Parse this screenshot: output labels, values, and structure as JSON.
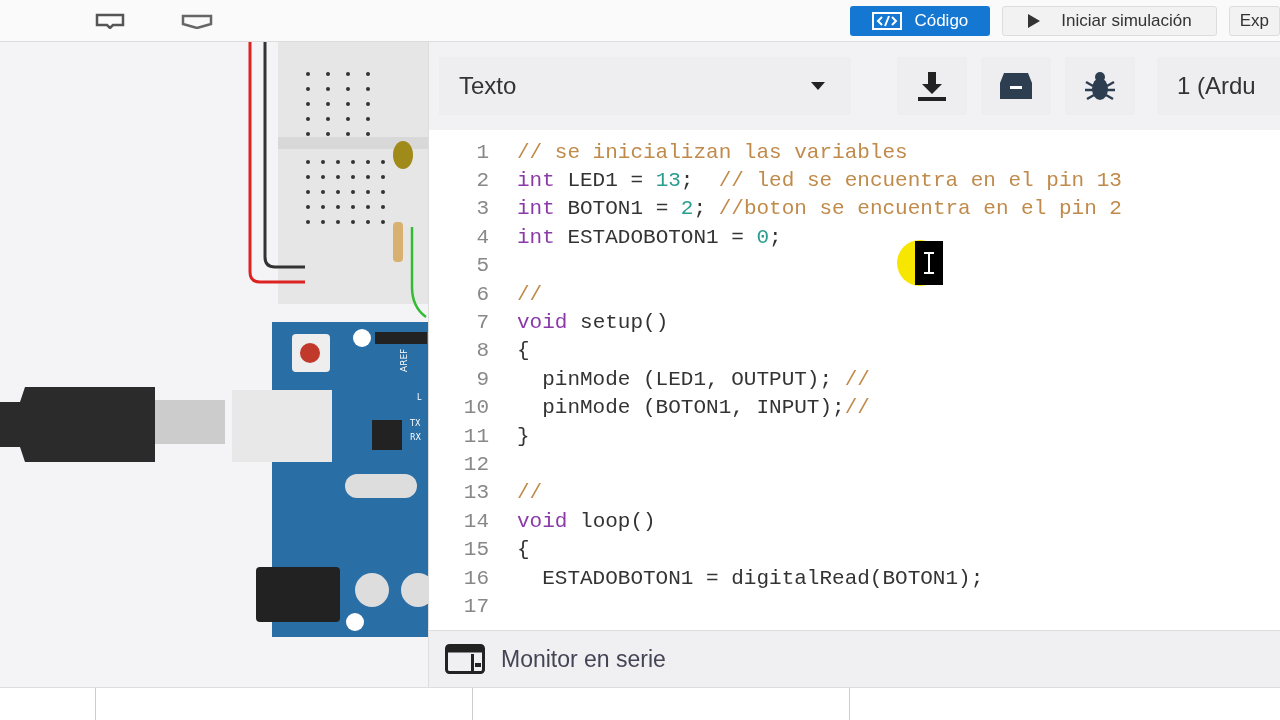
{
  "top_bar": {
    "code_button": "Código",
    "simulate_button": "Iniciar simulación",
    "export_button": "Exp"
  },
  "editor_toolbar": {
    "mode_select": "Texto",
    "board_select": "1 (Ardu"
  },
  "circuit": {
    "board_labels": [
      "AREF",
      "L",
      "TX",
      "RX"
    ]
  },
  "code": [
    {
      "number": "1",
      "tokens": [
        {
          "kind": "comment",
          "text": "// se inicializan las variables"
        }
      ]
    },
    {
      "number": "2",
      "tokens": [
        {
          "kind": "keyword",
          "text": "int"
        },
        {
          "kind": "plain",
          "text": " LED1 = "
        },
        {
          "kind": "number",
          "text": "13"
        },
        {
          "kind": "plain",
          "text": ";  "
        },
        {
          "kind": "comment",
          "text": "// led se encuentra en el pin 13"
        }
      ]
    },
    {
      "number": "3",
      "tokens": [
        {
          "kind": "keyword",
          "text": "int"
        },
        {
          "kind": "plain",
          "text": " BOTON1 = "
        },
        {
          "kind": "number",
          "text": "2"
        },
        {
          "kind": "plain",
          "text": "; "
        },
        {
          "kind": "comment",
          "text": "//boton se encuentra en el pin 2"
        }
      ]
    },
    {
      "number": "4",
      "tokens": [
        {
          "kind": "keyword",
          "text": "int"
        },
        {
          "kind": "plain",
          "text": " ESTADOBOTON1 = "
        },
        {
          "kind": "number",
          "text": "0"
        },
        {
          "kind": "plain",
          "text": ";"
        }
      ]
    },
    {
      "number": "5"
    },
    {
      "number": "6",
      "tokens": [
        {
          "kind": "comment",
          "text": "//"
        }
      ]
    },
    {
      "number": "7",
      "tokens": [
        {
          "kind": "keyword",
          "text": "void"
        },
        {
          "kind": "plain",
          "text": " setup()"
        }
      ]
    },
    {
      "number": "8",
      "tokens": [
        {
          "kind": "plain",
          "text": "{"
        }
      ]
    },
    {
      "number": "9",
      "tokens": [
        {
          "kind": "plain",
          "text": "  pinMode (LED1, OUTPUT); "
        },
        {
          "kind": "comment",
          "text": "//"
        }
      ]
    },
    {
      "number": "10",
      "tokens": [
        {
          "kind": "plain",
          "text": "  pinMode (BOTON1, INPUT);"
        },
        {
          "kind": "comment",
          "text": "//"
        }
      ]
    },
    {
      "number": "11",
      "tokens": [
        {
          "kind": "plain",
          "text": "}"
        }
      ]
    },
    {
      "number": "12"
    },
    {
      "number": "13",
      "tokens": [
        {
          "kind": "comment",
          "text": "//"
        }
      ]
    },
    {
      "number": "14",
      "tokens": [
        {
          "kind": "keyword",
          "text": "void"
        },
        {
          "kind": "plain",
          "text": " loop()"
        }
      ]
    },
    {
      "number": "15",
      "tokens": [
        {
          "kind": "plain",
          "text": "{"
        }
      ]
    },
    {
      "number": "16",
      "tokens": [
        {
          "kind": "plain",
          "text": "  ESTADOBOTON1 = digitalRead(BOTON1);"
        }
      ]
    },
    {
      "number": "17"
    }
  ],
  "serial_monitor": {
    "label": "Monitor en serie"
  }
}
